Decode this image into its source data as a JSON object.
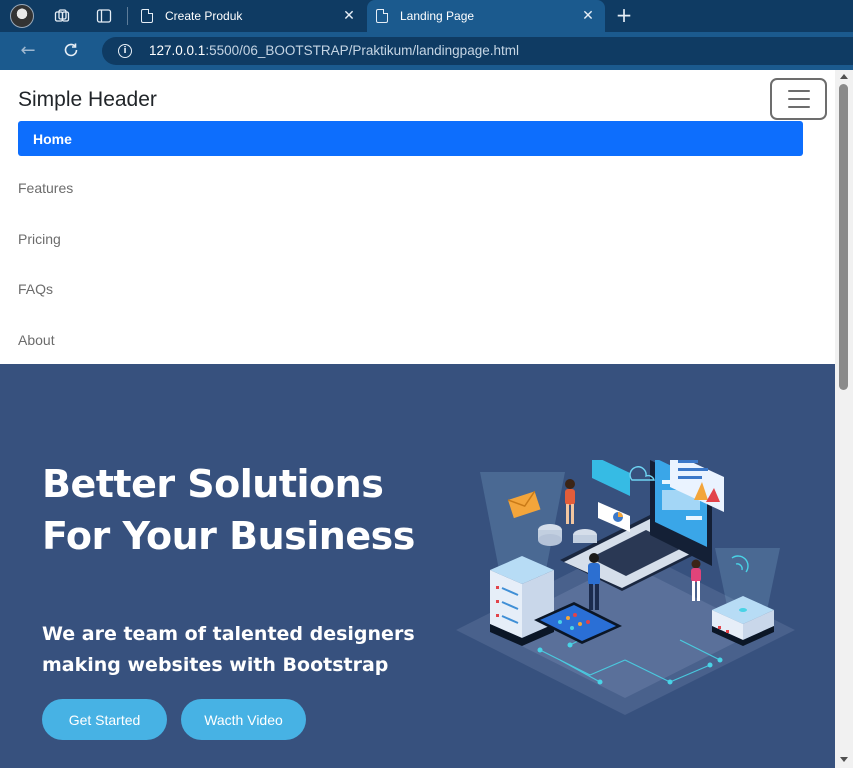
{
  "browser": {
    "tabs": [
      {
        "title": "Create Produk"
      },
      {
        "title": "Landing Page"
      }
    ],
    "url": {
      "host": "127.0.0.1",
      "rest": ":5500/06_BOOTSTRAP/Praktikum/landingpage.html"
    }
  },
  "navbar": {
    "brand": "Simple Header",
    "items": [
      {
        "label": "Home"
      },
      {
        "label": "Features"
      },
      {
        "label": "Pricing"
      },
      {
        "label": "FAQs"
      },
      {
        "label": "About"
      }
    ]
  },
  "hero": {
    "title": "Better Solutions For Your Business",
    "subtitle": "We are team of talented designers making websites with Bootstrap",
    "buttons": [
      {
        "label": "Get Started"
      },
      {
        "label": "Wacth Video"
      }
    ]
  },
  "colors": {
    "tabbar": "#0f3b63",
    "addressbar": "#1b5a8e",
    "nav_active": "#0d6efd",
    "hero_bg": "#37517e",
    "hero_button": "#47b2e4"
  },
  "icons": [
    "profile-avatar-icon",
    "workspaces-icon",
    "tab-actions-icon",
    "page-icon",
    "close-icon",
    "new-tab-icon",
    "back-arrow-icon",
    "reload-icon",
    "info-icon",
    "hamburger-icon"
  ]
}
